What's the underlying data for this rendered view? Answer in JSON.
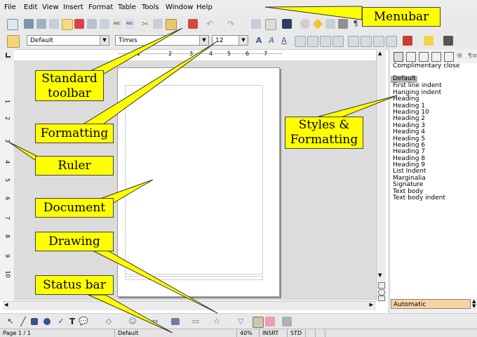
{
  "menubar": {
    "items": [
      "File",
      "Edit",
      "View",
      "Insert",
      "Format",
      "Table",
      "Tools",
      "Window",
      "Help"
    ]
  },
  "formatting": {
    "paragraph_style": "Default",
    "font_name": "Times",
    "font_size": "12"
  },
  "styles_panel": {
    "selected": "Default",
    "items": [
      "Complimentary close",
      "Default",
      "First line indent",
      "Hanging indent",
      "Heading",
      "Heading 1",
      "Heading 10",
      "Heading 2",
      "Heading 3",
      "Heading 4",
      "Heading 5",
      "Heading 6",
      "Heading 7",
      "Heading 8",
      "Heading 9",
      "List Indent",
      "Marginalia",
      "Signature",
      "Text body",
      "Text body indent"
    ],
    "filter": "Automatic"
  },
  "ruler": {
    "horizontal_ticks": [
      "1",
      "2",
      "3",
      "4",
      "5",
      "6",
      "7"
    ],
    "vertical_ticks": [
      "1",
      "2",
      "3",
      "4",
      "5",
      "6",
      "7",
      "8",
      "9",
      "10"
    ]
  },
  "statusbar": {
    "page": "Page 1 / 1",
    "style": "Default",
    "zoom": "40%",
    "insert_mode": "INSRT",
    "selection_mode": "STD"
  },
  "callouts": {
    "menubar": "Menubar",
    "standard_toolbar": "Standard toolbar",
    "formatting": "Formatting",
    "styles_formatting": "Styles & Formatting",
    "ruler": "Ruler",
    "document": "Document",
    "drawing": "Drawing",
    "status_bar": "Status bar"
  },
  "colors": {
    "callout_fill": "#ffff00",
    "toolbar_bg": "#e9e9e9",
    "selection_accent": "#ff9a3c"
  }
}
